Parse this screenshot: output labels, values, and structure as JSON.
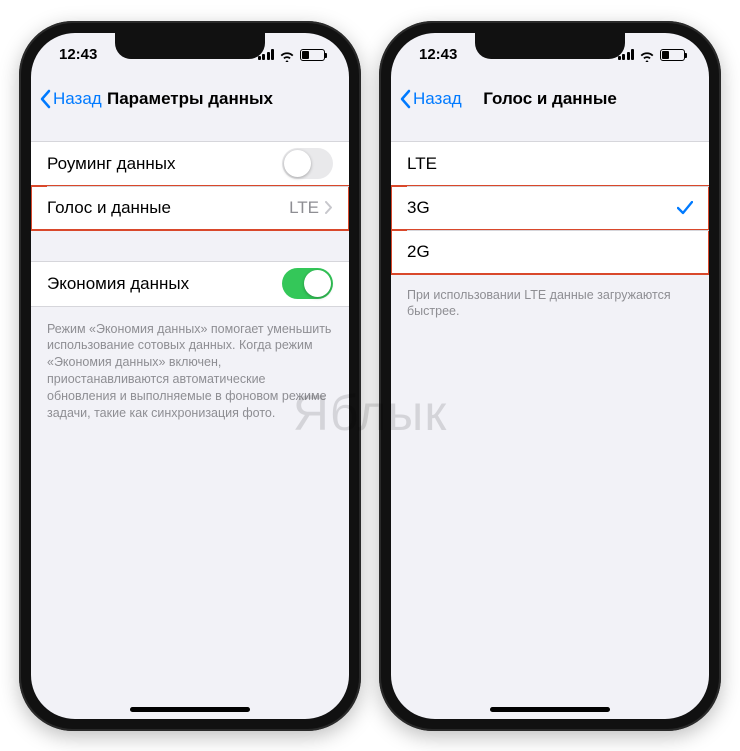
{
  "watermark": "Яблык",
  "status": {
    "time": "12:43"
  },
  "left": {
    "back": "Назад",
    "title": "Параметры данных",
    "rows": {
      "roaming": {
        "label": "Роуминг данных",
        "on": false
      },
      "voice": {
        "label": "Голос и данные",
        "value": "LTE"
      },
      "lowdata": {
        "label": "Экономия данных",
        "on": true
      }
    },
    "footer": "Режим «Экономия данных» помогает уменьшить использование сотовых данных. Когда режим «Экономия данных» включен, приостанавливаются автоматические обновления и выполняемые в фоновом режиме задачи, такие как синхронизация фото."
  },
  "right": {
    "back": "Назад",
    "title": "Голос и данные",
    "options": {
      "lte": {
        "label": "LTE",
        "selected": false
      },
      "g3": {
        "label": "3G",
        "selected": true
      },
      "g2": {
        "label": "2G",
        "selected": false
      }
    },
    "footer": "При использовании LTE данные загружаются быстрее."
  }
}
